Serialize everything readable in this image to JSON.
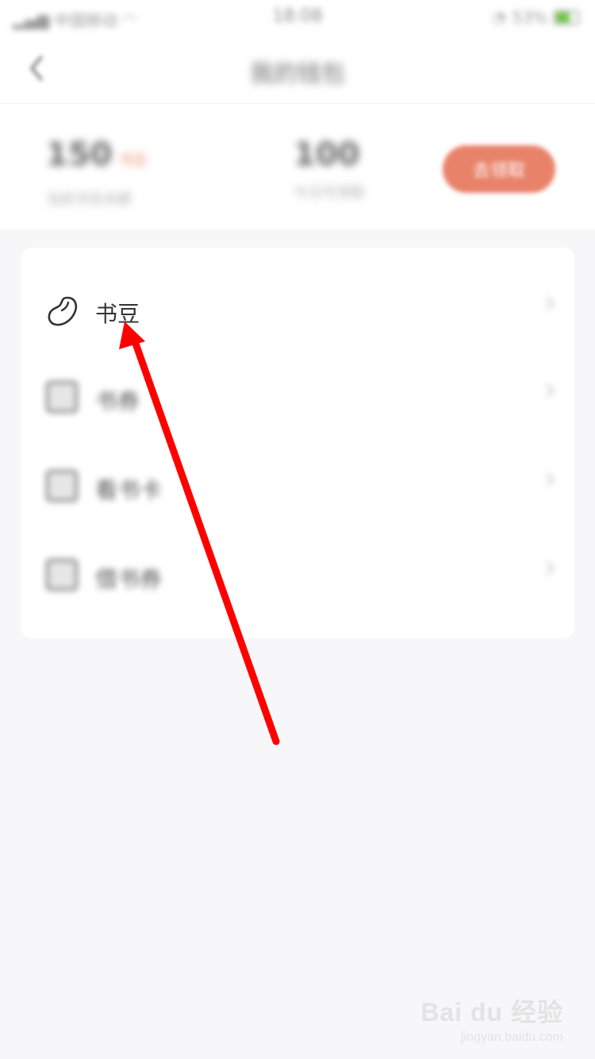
{
  "status_bar": {
    "carrier": "中国移动",
    "time": "18:08",
    "battery": "53%"
  },
  "nav": {
    "title": "我的钱包",
    "back_icon": "chevron-left-icon"
  },
  "summary": {
    "balance_value": "150",
    "balance_unit": "书豆",
    "balance_label": "当前书豆余额",
    "second_value": "100",
    "second_label": "今日可领取",
    "action_label": "去领取"
  },
  "wallet_items": [
    {
      "label": "书豆",
      "value": "",
      "icon": "bean-icon"
    },
    {
      "label": "书券",
      "value": "",
      "icon": "coupon-icon"
    },
    {
      "label": "看书卡",
      "value": "",
      "icon": "card-icon"
    },
    {
      "label": "借书券",
      "value": "",
      "icon": "ticket-icon"
    }
  ],
  "annotation": {
    "arrow_color": "#ff0000"
  },
  "watermark": {
    "main": "Bai du 经验",
    "sub": "jingyan.baidu.com"
  }
}
